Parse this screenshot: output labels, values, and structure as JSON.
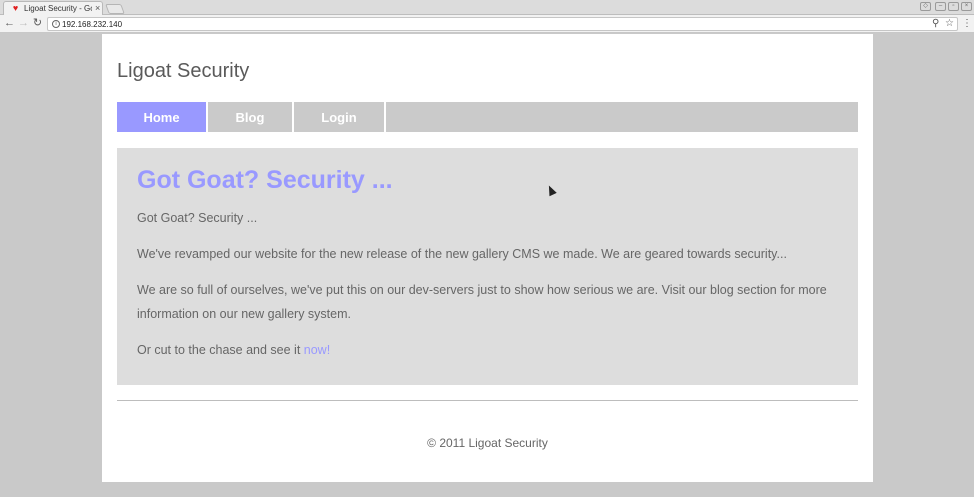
{
  "browser": {
    "tab_title": "Ligoat Security - Go",
    "url": "192.168.232.140"
  },
  "site": {
    "title": "Ligoat Security"
  },
  "nav": {
    "items": [
      {
        "label": "Home",
        "active": true
      },
      {
        "label": "Blog",
        "active": false
      },
      {
        "label": "Login",
        "active": false
      }
    ]
  },
  "main": {
    "headline": "Got Goat? Security ...",
    "paragraphs": [
      "Got Goat? Security ...",
      "We've revamped our website for the new release of the new gallery CMS we made. We are geared towards security...",
      "We are so full of ourselves, we've put this on our dev-servers just to show how serious we are. Visit our blog section for more information on our new gallery system."
    ],
    "cta_text": "Or cut to the chase and see it ",
    "cta_link": "now!"
  },
  "footer": {
    "text": "© 2011 Ligoat Security"
  },
  "colors": {
    "accent": "#9999ff",
    "nav_bg": "#cacaca",
    "content_bg": "#dddddd"
  }
}
